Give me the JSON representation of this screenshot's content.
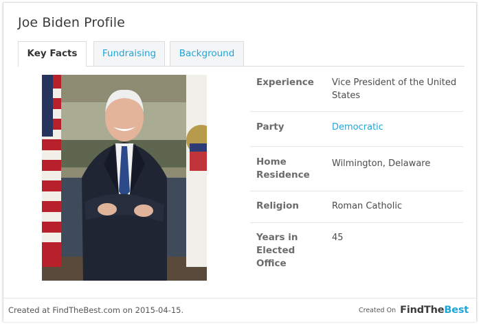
{
  "profile": {
    "title": "Joe Biden Profile"
  },
  "tabs": [
    {
      "label": "Key Facts",
      "active": true
    },
    {
      "label": "Fundraising",
      "active": false
    },
    {
      "label": "Background",
      "active": false
    }
  ],
  "facts": [
    {
      "label": "Experience",
      "value": "Vice President of the United States"
    },
    {
      "label": "Party",
      "value": "Democratic"
    },
    {
      "label": "Home Residence",
      "value": "Wilmington, Delaware"
    },
    {
      "label": "Religion",
      "value": "Roman Catholic"
    },
    {
      "label": "Years in Elected Office",
      "value": "45"
    }
  ],
  "footer": {
    "created_text": "Created at FindTheBest.com on 2015-04-15.",
    "created_on_label": "Created On",
    "brand_part1": "FindThe",
    "brand_part2": "Best"
  },
  "colors": {
    "accent": "#1fa6d8",
    "title_text": "#3a3a3a"
  }
}
